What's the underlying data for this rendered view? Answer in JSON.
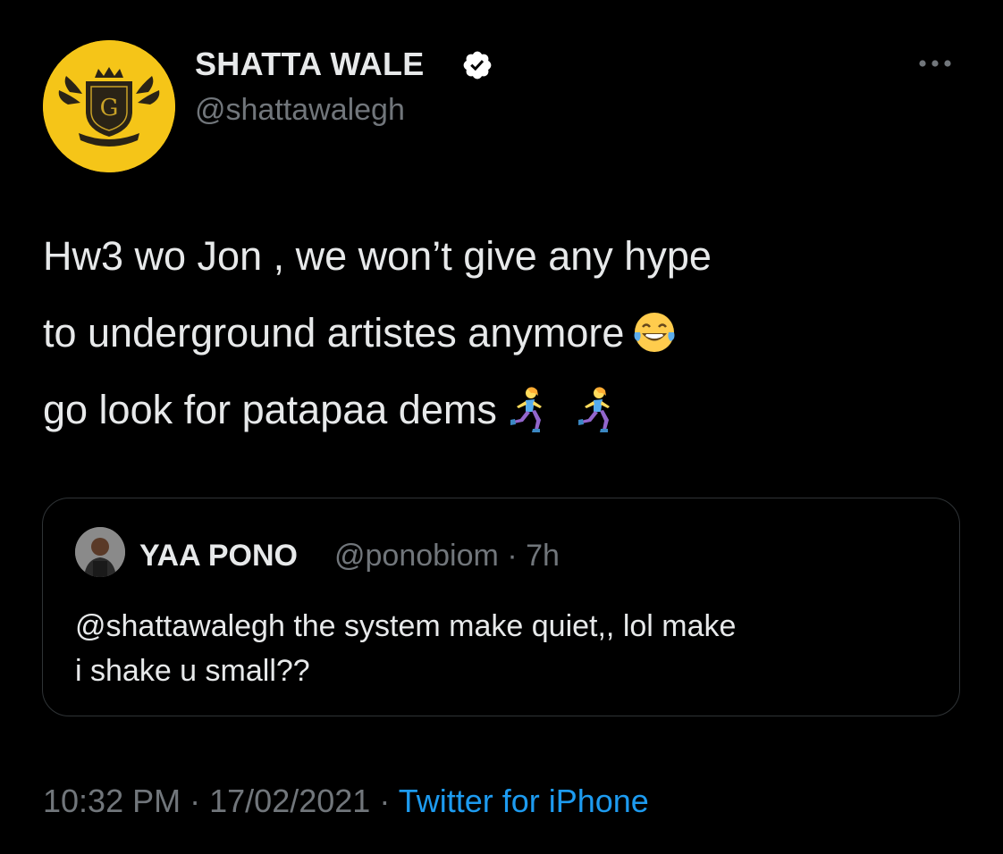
{
  "author": {
    "name": "SHATTA WALE",
    "handle": "@shattawalegh",
    "verified": true,
    "avatar_color": "#f5c518"
  },
  "tweet": {
    "lines": [
      "Hw3 wo Jon , we won’t give any hype",
      "to underground artistes anymore",
      "go look for patapaa dems"
    ],
    "emojis": [
      "laughing-tears-emoji",
      "woman-running-emoji",
      "woman-running-emoji"
    ]
  },
  "quote": {
    "name": "YAA PONO",
    "handle": "@ponobiom",
    "separator": "·",
    "time": "7h",
    "lines": [
      "@shattawalegh the system make quiet,, lol make",
      "i shake u small??"
    ]
  },
  "footer": {
    "time": "10:32 PM",
    "sep1": "·",
    "date": "17/02/2021",
    "sep2": "·",
    "source": "Twitter for iPhone"
  },
  "colors": {
    "background": "#000000",
    "text": "#e7e9ea",
    "muted": "#71767b",
    "link": "#1d9bf0",
    "border": "#2f3336"
  }
}
